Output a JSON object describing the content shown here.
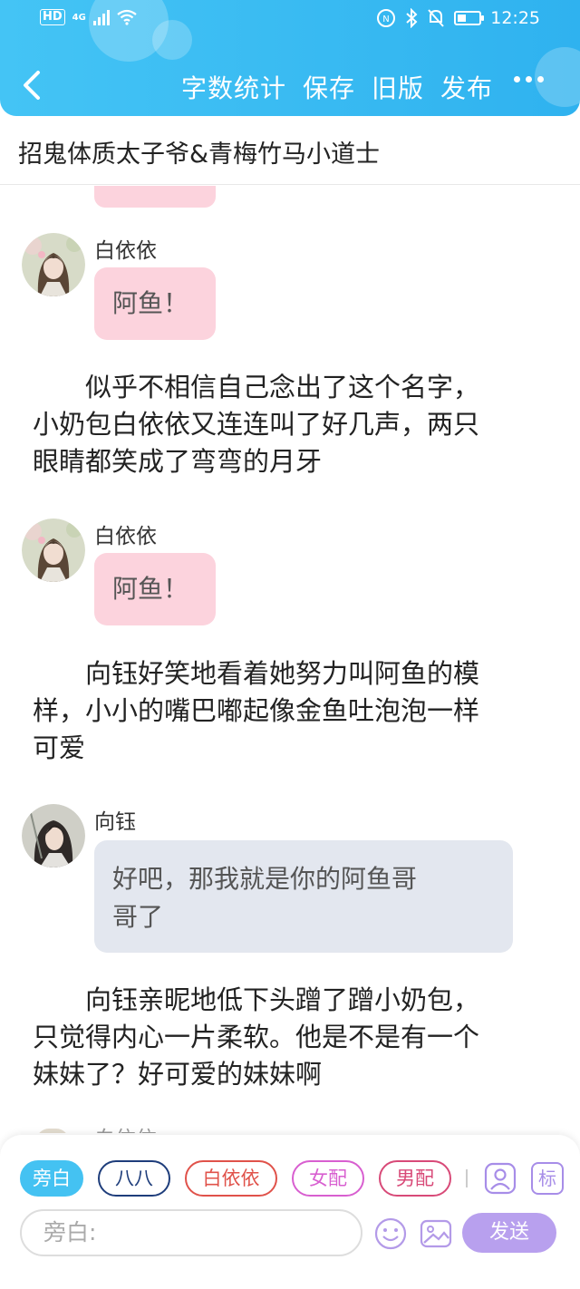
{
  "status_bar": {
    "network_label": "HD",
    "network_gen": "4G",
    "time": "12:25",
    "battery_percent": 40
  },
  "nav": {
    "actions": [
      "字数统计",
      "保存",
      "旧版",
      "发布"
    ]
  },
  "story_title": "招鬼体质太子爷&青梅竹马小道士",
  "messages": [
    {
      "speaker": "白依依",
      "text": "阿鱼！",
      "style": "pink"
    },
    {
      "speaker": "白依依",
      "text": "阿鱼！",
      "style": "pink"
    },
    {
      "speaker": "向钰",
      "line1": "好吧，那我就是你的阿鱼哥",
      "line2": "哥了",
      "style": "gray"
    }
  ],
  "narrations": [
    {
      "lines": [
        "似乎不相信自己念出了这个名字，",
        "小奶包白依依又连连叫了好几声，两只",
        "眼睛都笑成了弯弯的月牙"
      ]
    },
    {
      "lines": [
        "向钰好笑地看着她努力叫阿鱼的模",
        "样，小小的嘴巴嘟起像金鱼吐泡泡一样",
        "可爱"
      ]
    },
    {
      "lines": [
        "向钰亲昵地低下头蹭了蹭小奶包，",
        "只觉得内心一片柔软。他是不是有一个",
        "妹妹了？好可爱的妹妹啊"
      ]
    }
  ],
  "next_speaker_peek": "白依依",
  "role_chips": [
    {
      "label": "旁白",
      "color": "#44c2f2",
      "active": true
    },
    {
      "label": "八八",
      "color": "#1e3d7b",
      "active": false
    },
    {
      "label": "白依依",
      "color": "#e0524a",
      "active": false
    },
    {
      "label": "女配",
      "color": "#d85fd0",
      "active": false
    },
    {
      "label": "男配",
      "color": "#d84a78",
      "active": false
    }
  ],
  "tools": {
    "role_icon": "person-card-icon",
    "tag_label": "标"
  },
  "input": {
    "placeholder": "旁白:",
    "send_label": "发送"
  }
}
